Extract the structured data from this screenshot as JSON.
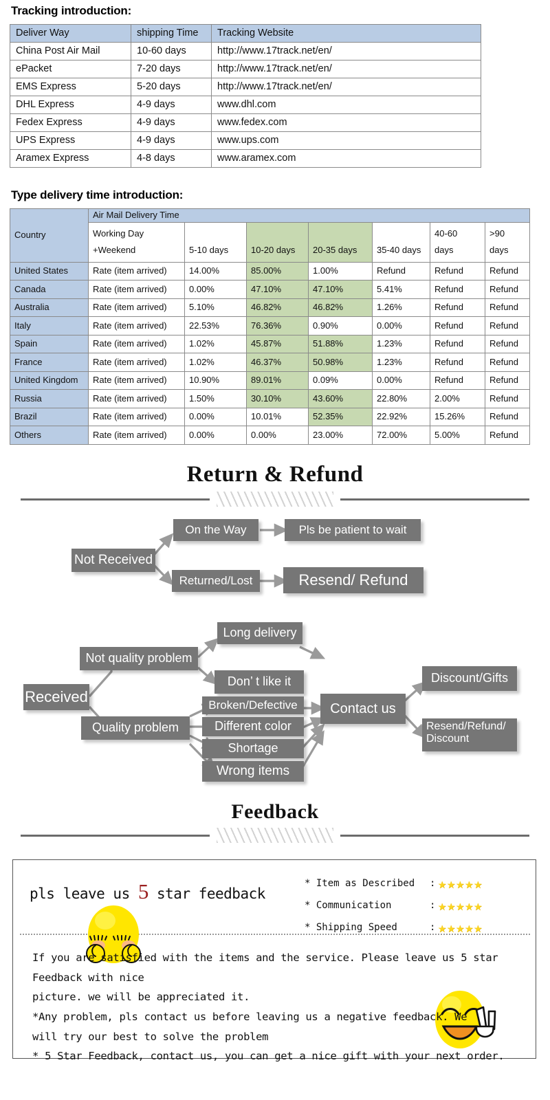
{
  "tracking": {
    "heading": "Tracking introduction:",
    "columns": [
      "Deliver Way",
      "shipping Time",
      "Tracking Website"
    ],
    "rows": [
      [
        "China Post Air Mail",
        "10-60 days",
        "http://www.17track.net/en/"
      ],
      [
        "ePacket",
        "7-20 days",
        "http://www.17track.net/en/"
      ],
      [
        "EMS Express",
        "5-20 days",
        "http://www.17track.net/en/"
      ],
      [
        "DHL Express",
        "4-9 days",
        "www.dhl.com"
      ],
      [
        "Fedex Express",
        "4-9 days",
        "www.fedex.com"
      ],
      [
        "UPS Express",
        "4-9 days",
        "www.ups.com"
      ],
      [
        "Aramex Express",
        "4-8 days",
        "www.aramex.com"
      ]
    ]
  },
  "delivery": {
    "heading": "Type delivery time introduction:",
    "country_header": "Country",
    "group_header": "Air Mail Delivery Time",
    "sub_headers": [
      "Working Day",
      "+Weekend",
      "5-10 days",
      "10-20 days",
      "20-35 days",
      "35-40 days",
      "40-60 days",
      ">90 days"
    ],
    "sub_header_cells": [
      {
        "line1": "Working Day",
        "line2": "+Weekend",
        "green": false
      },
      {
        "line1": "",
        "line2": "5-10 days",
        "green": false
      },
      {
        "line1": "",
        "line2": "10-20 days",
        "green": true
      },
      {
        "line1": "",
        "line2": "20-35 days",
        "green": true
      },
      {
        "line1": "",
        "line2": "35-40 days",
        "green": false
      },
      {
        "line1": "40-60",
        "line2": "days",
        "green": false
      },
      {
        "line1": ">90",
        "line2": "days",
        "green": false
      }
    ],
    "rate_label": "Rate (item arrived)",
    "rows": [
      {
        "country": "United States",
        "values": [
          "14.00%",
          "85.00%",
          "1.00%",
          "Refund",
          "Refund",
          "Refund"
        ],
        "green": [
          false,
          true,
          false,
          false,
          false,
          false
        ]
      },
      {
        "country": "Canada",
        "values": [
          "0.00%",
          "47.10%",
          "47.10%",
          "5.41%",
          "Refund",
          "Refund"
        ],
        "green": [
          false,
          true,
          true,
          false,
          false,
          false
        ]
      },
      {
        "country": "Australia",
        "values": [
          "5.10%",
          "46.82%",
          "46.82%",
          "1.26%",
          "Refund",
          "Refund"
        ],
        "green": [
          false,
          true,
          true,
          false,
          false,
          false
        ]
      },
      {
        "country": "Italy",
        "values": [
          "22.53%",
          "76.36%",
          "0.90%",
          "0.00%",
          "Refund",
          "Refund"
        ],
        "green": [
          false,
          true,
          false,
          false,
          false,
          false
        ]
      },
      {
        "country": "Spain",
        "values": [
          "1.02%",
          "45.87%",
          "51.88%",
          "1.23%",
          "Refund",
          "Refund"
        ],
        "green": [
          false,
          true,
          true,
          false,
          false,
          false
        ]
      },
      {
        "country": "France",
        "values": [
          "1.02%",
          "46.37%",
          "50.98%",
          "1.23%",
          "Refund",
          "Refund"
        ],
        "green": [
          false,
          true,
          true,
          false,
          false,
          false
        ]
      },
      {
        "country": "United Kingdom",
        "values": [
          "10.90%",
          "89.01%",
          "0.09%",
          "0.00%",
          "Refund",
          "Refund"
        ],
        "green": [
          false,
          true,
          false,
          false,
          false,
          false
        ]
      },
      {
        "country": "Russia",
        "values": [
          "1.50%",
          "30.10%",
          "43.60%",
          "22.80%",
          "2.00%",
          "Refund"
        ],
        "green": [
          false,
          true,
          true,
          false,
          false,
          false
        ]
      },
      {
        "country": "Brazil",
        "values": [
          "0.00%",
          "10.01%",
          "52.35%",
          "22.92%",
          "15.26%",
          "Refund"
        ],
        "green": [
          false,
          false,
          true,
          false,
          false,
          false
        ]
      },
      {
        "country": "Others",
        "values": [
          "0.00%",
          "0.00%",
          "23.00%",
          "72.00%",
          "5.00%",
          "Refund"
        ],
        "green": [
          false,
          false,
          false,
          false,
          false,
          false
        ]
      }
    ]
  },
  "return_section": {
    "title": "Return & Refund",
    "nodes": {
      "not_received": "Not Received",
      "on_the_way": "On the Way",
      "pls_wait": "Pls be patient to wait",
      "returned_lost": "Returned/Lost",
      "resend_refund": "Resend/ Refund",
      "received": "Received",
      "not_quality": "Not quality problem",
      "quality": "Quality problem",
      "long_delivery": "Long delivery",
      "dont_like": "Don’  t like it",
      "broken": "Broken/Defective",
      "different_color": "Different color",
      "shortage": "Shortage",
      "wrong_items": "Wrong items",
      "contact_us": "Contact us",
      "discount_gifts": "Discount/Gifts",
      "resend_refund_discount": "Resend/Refund/ Discount"
    }
  },
  "feedback": {
    "title": "Feedback",
    "plea_before": "pls leave us ",
    "plea_star": "5",
    "plea_after": " star feedback",
    "ratings": [
      {
        "label": "* Item as Described",
        "colon": ":",
        "stars": "★★★★★"
      },
      {
        "label": "* Communication",
        "colon": ":",
        "stars": "★★★★★"
      },
      {
        "label": "* Shipping Speed",
        "colon": ":",
        "stars": "★★★★★"
      }
    ],
    "body_lines": [
      "If you are satisfied with the items and the service. Please leave us 5 star Feedback with nice",
      "picture. we will be appreciated it.",
      "*Any problem, pls contact us before leaving us a negative feedback. We",
      "will try our best to solve  the problem",
      "* 5 Star Feedback, contact us, you can get a nice gift with your next order."
    ]
  }
}
